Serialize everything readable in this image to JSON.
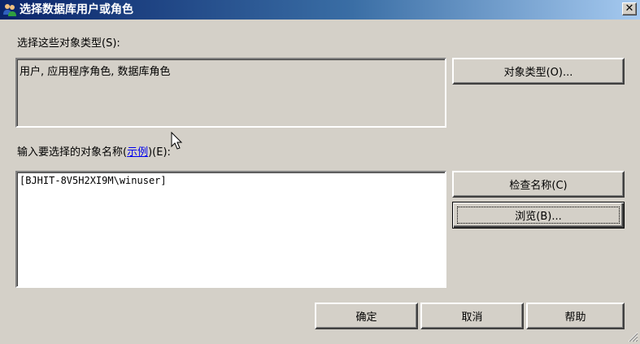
{
  "window": {
    "title": "选择数据库用户或角色",
    "close_glyph": "✕"
  },
  "object_types": {
    "label": "选择这些对象类型(S):",
    "value": "用户, 应用程序角色, 数据库角色",
    "button_label": "对象类型(O)..."
  },
  "object_names": {
    "label_prefix": "输入要选择的对象名称(",
    "link_text": "示例",
    "label_suffix": ")(E):",
    "value": "[BJHIT-8V5H2XI9M\\winuser]",
    "check_button_label": "检查名称(C)",
    "browse_button_label": "浏览(B)..."
  },
  "footer": {
    "ok_label": "确定",
    "cancel_label": "取消",
    "help_label": "帮助"
  },
  "icons": {
    "app": "users-icon",
    "close": "close-icon",
    "cursor": "mouse-pointer-icon",
    "grip": "resize-grip-icon"
  }
}
